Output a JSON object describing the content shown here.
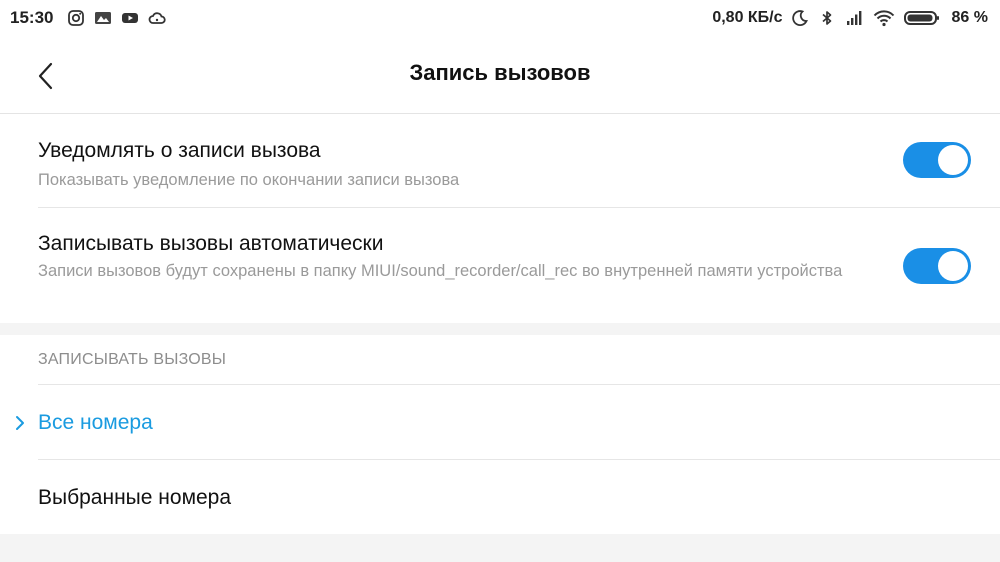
{
  "status_bar": {
    "time": "15:30",
    "left_icons": [
      "instagram-icon",
      "gallery-icon",
      "youtube-icon",
      "cloud-icon"
    ],
    "speed": "0,80 КБ/с",
    "right_icons": [
      "moon-icon",
      "bluetooth-icon",
      "signal-icon",
      "wifi-icon",
      "battery-icon"
    ],
    "battery": "86 %"
  },
  "header": {
    "title": "Запись вызовов"
  },
  "settings": [
    {
      "title": "Уведомлять о записи вызова",
      "subtitle": "Показывать уведомление по окончании записи вызова",
      "enabled": true
    },
    {
      "title": "Записывать вызовы автоматически",
      "subtitle": "Записи вызовов будут сохранены в папку MIUI/sound_recorder/call_rec во внутренней памяти устройства",
      "enabled": true
    }
  ],
  "record_section": {
    "label": "ЗАПИСЫВАТЬ ВЫЗОВЫ",
    "options": [
      {
        "label": "Все номера",
        "selected": true
      },
      {
        "label": "Выбранные номера",
        "selected": false
      }
    ]
  },
  "colors": {
    "accent": "#1a8fe6",
    "selected_text": "#1a9be0",
    "subtitle": "#9a9a9a",
    "band": "#f4f4f4"
  }
}
